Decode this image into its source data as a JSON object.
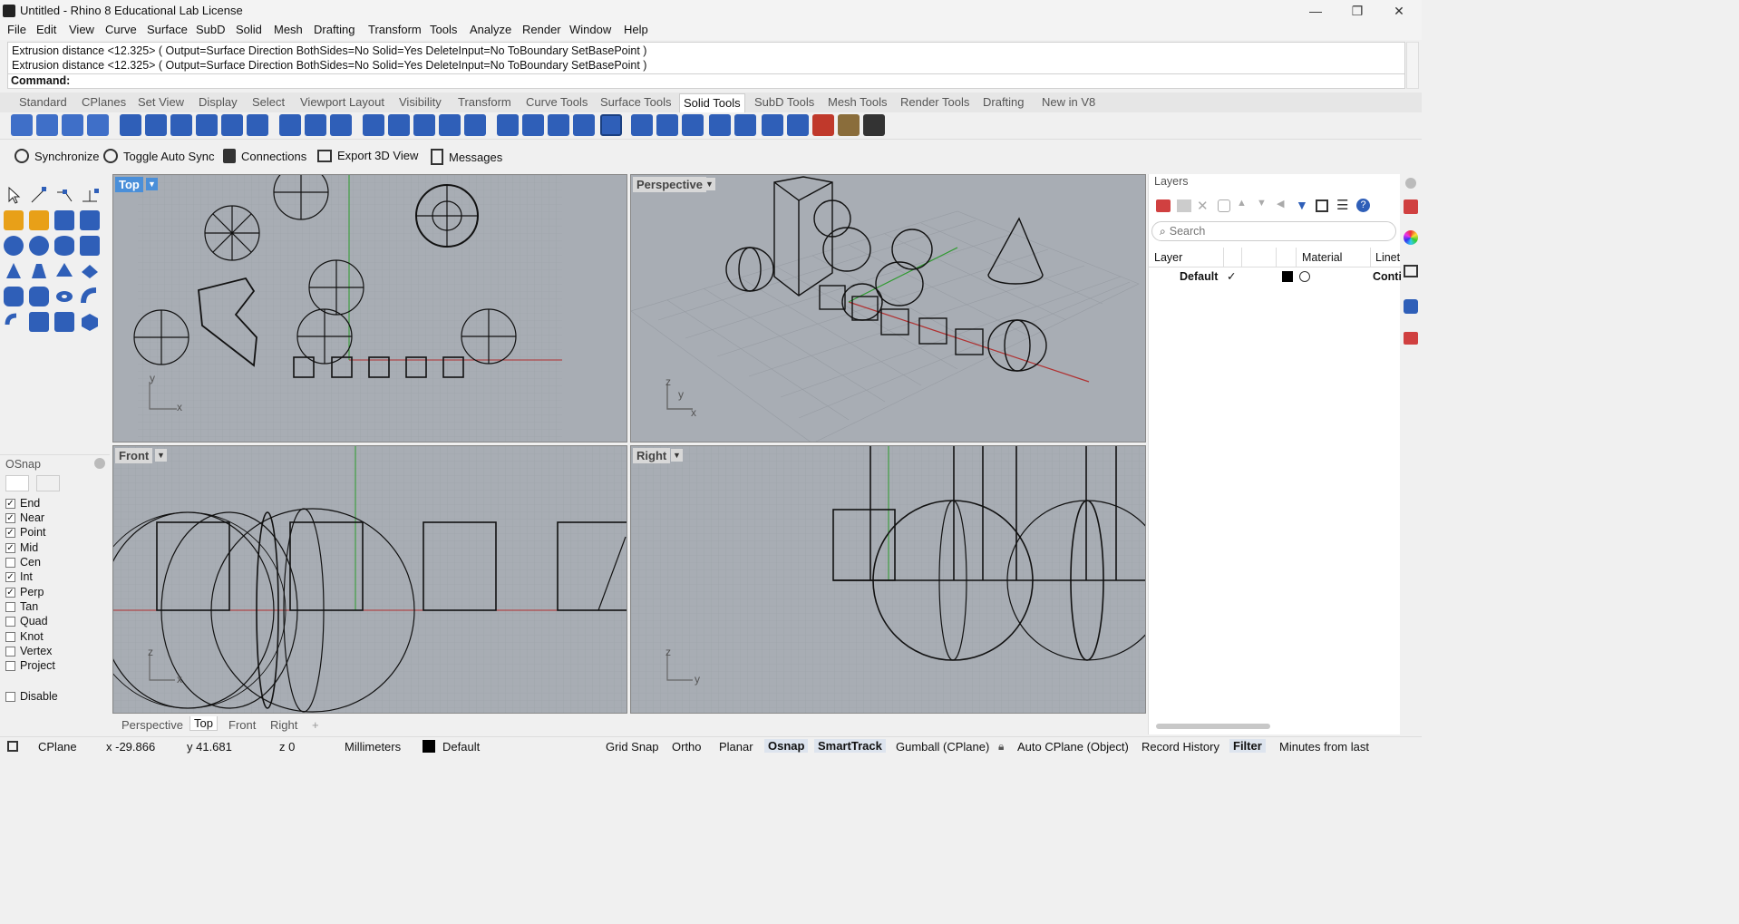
{
  "window": {
    "title": "Untitled - Rhino 8 Educational Lab License"
  },
  "menu": [
    "File",
    "Edit",
    "View",
    "Curve",
    "Surface",
    "SubD",
    "Solid",
    "Mesh",
    "Drafting",
    "Transform",
    "Tools",
    "Analyze",
    "Render",
    "Window",
    "Help"
  ],
  "command": {
    "history": [
      "Extrusion distance <12.325> ( Output=Surface  Direction  BothSides=No  Solid=Yes  DeleteInput=No  ToBoundary  SetBasePoint )",
      "Extrusion distance <12.325> ( Output=Surface  Direction  BothSides=No  Solid=Yes  DeleteInput=No  ToBoundary  SetBasePoint )"
    ],
    "prompt": "Command:"
  },
  "tabs": [
    "Standard",
    "CPlanes",
    "Set View",
    "Display",
    "Select",
    "Viewport Layout",
    "Visibility",
    "Transform",
    "Curve Tools",
    "Surface Tools",
    "Solid Tools",
    "SubD Tools",
    "Mesh Tools",
    "Render Tools",
    "Drafting",
    "New in V8"
  ],
  "active_tab": "Solid Tools",
  "plugin_bar": [
    "Synchronize",
    "Toggle Auto Sync",
    "Connections",
    "Export 3D View",
    "Messages"
  ],
  "viewports": {
    "top": "Top",
    "perspective": "Perspective",
    "front": "Front",
    "right": "Right"
  },
  "axis_labels": {
    "x": "x",
    "y": "y",
    "z": "z"
  },
  "viewport_tabs": [
    "Perspective",
    "Top",
    "Front",
    "Right"
  ],
  "active_viewport_tab": "Top",
  "osnap": {
    "title": "OSnap",
    "items": [
      {
        "label": "End",
        "checked": true
      },
      {
        "label": "Near",
        "checked": true
      },
      {
        "label": "Point",
        "checked": true
      },
      {
        "label": "Mid",
        "checked": true
      },
      {
        "label": "Cen",
        "checked": false
      },
      {
        "label": "Int",
        "checked": true
      },
      {
        "label": "Perp",
        "checked": true
      },
      {
        "label": "Tan",
        "checked": false
      },
      {
        "label": "Quad",
        "checked": false
      },
      {
        "label": "Knot",
        "checked": false
      },
      {
        "label": "Vertex",
        "checked": false
      },
      {
        "label": "Project",
        "checked": false
      }
    ],
    "disable": "Disable"
  },
  "layers": {
    "title": "Layers",
    "search_placeholder": "Search",
    "columns": [
      "Layer",
      "Material",
      "Linet"
    ],
    "rows": [
      {
        "name": "Default",
        "check": "✓",
        "linetype": "Conti"
      }
    ]
  },
  "status": {
    "cplane": "CPlane",
    "x": "x -29.866",
    "y": "y 41.681",
    "z": "z 0",
    "units": "Millimeters",
    "layer": "Default",
    "toggles": [
      "Grid Snap",
      "Ortho",
      "Planar",
      "Osnap",
      "SmartTrack",
      "Gumball (CPlane)",
      "Auto CPlane (Object)",
      "Record History",
      "Filter",
      "Minutes from last"
    ]
  }
}
